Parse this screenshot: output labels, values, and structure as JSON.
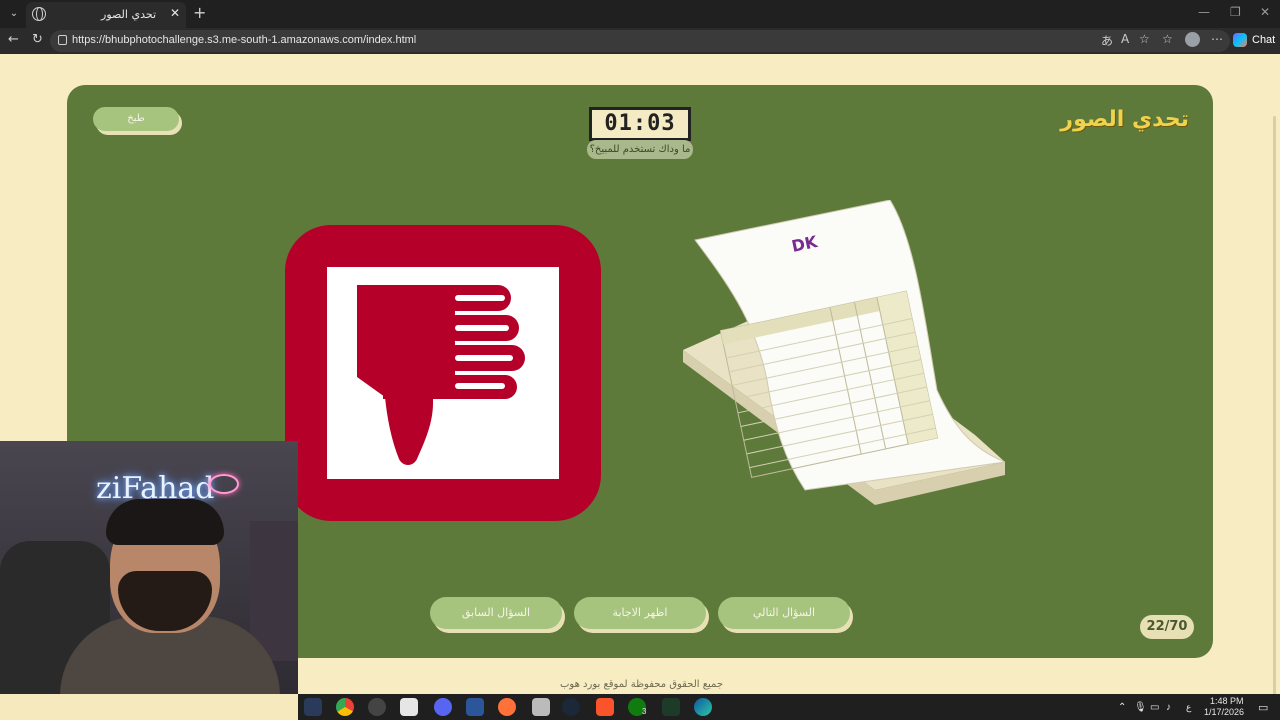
{
  "browser": {
    "tab_title": "تحدي الصور",
    "url": "https://bhubphotochallenge.s3.me-south-1.amazonaws.com/index.html",
    "chat_label": "Chat"
  },
  "game": {
    "brand": "تحدي الصور",
    "timer": "01:03",
    "hint": "ما وداك تستخدم للمبيخ؟",
    "cook_button": "طبخ",
    "counter": "22/70",
    "buttons": {
      "prev": "السؤال السابق",
      "reveal": "اظهر الاجابة",
      "next": "السؤال التالي"
    },
    "footer": "جميع الحقوق محفوظة لموقع بورد هوب"
  },
  "stream": {
    "overlay_name": "ziFahad"
  },
  "taskbar": {
    "lang": "ع",
    "time": "1:48 PM",
    "date": "1/17/2026",
    "xbox_badge": "3"
  },
  "colors": {
    "card_green": "#5e7a3b",
    "page_cream": "#f7ecc2",
    "brand_gold": "#f1d24c",
    "thumbs_red": "#b5002a"
  }
}
